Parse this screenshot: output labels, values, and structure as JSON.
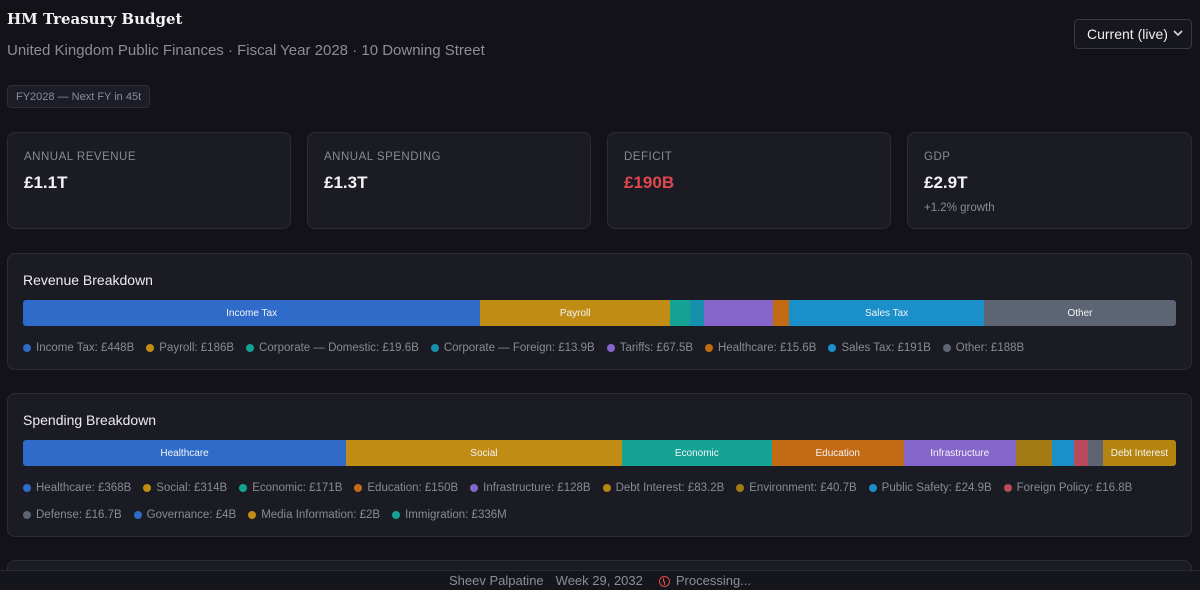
{
  "header": {
    "title": "HM Treasury Budget",
    "subtitle": "United Kingdom Public Finances · Fiscal Year 2028 · 10 Downing Street",
    "view_selected": "Current (live)",
    "fy_badge": "FY2028 — Next FY in 45t"
  },
  "stats": [
    {
      "label": "Annual Revenue",
      "value": "£1.1T",
      "sub": ""
    },
    {
      "label": "Annual Spending",
      "value": "£1.3T",
      "sub": ""
    },
    {
      "label": "Deficit",
      "value": "£190B",
      "sub": "",
      "color": "#e0484d"
    },
    {
      "label": "GDP",
      "value": "£2.9T",
      "sub": "+1.2% growth"
    }
  ],
  "revenue": {
    "title": "Revenue Breakdown",
    "segments": [
      {
        "name": "Income Tax",
        "value": 448,
        "bar_label": "Income Tax",
        "legend": "Income Tax: £448B",
        "color": "#2f6bc9"
      },
      {
        "name": "Payroll",
        "value": 186,
        "bar_label": "Payroll",
        "legend": "Payroll: £186B",
        "color": "#c08c14"
      },
      {
        "name": "Corporate — Domestic",
        "value": 19.6,
        "bar_label": "",
        "legend": "Corporate — Domestic: £19.6B",
        "color": "#14a294"
      },
      {
        "name": "Corporate — Foreign",
        "value": 13.9,
        "bar_label": "",
        "legend": "Corporate — Foreign: £13.9B",
        "color": "#1790ad"
      },
      {
        "name": "Tariffs",
        "value": 67.5,
        "bar_label": "",
        "legend": "Tariffs: £67.5B",
        "color": "#8466cb"
      },
      {
        "name": "Healthcare",
        "value": 15.6,
        "bar_label": "",
        "legend": "Healthcare: £15.6B",
        "color": "#c26a14"
      },
      {
        "name": "Sales Tax",
        "value": 191,
        "bar_label": "Sales Tax",
        "legend": "Sales Tax: £191B",
        "color": "#1a8fca"
      },
      {
        "name": "Other",
        "value": 188,
        "bar_label": "Other",
        "legend": "Other: £188B",
        "color": "#5d6473"
      }
    ]
  },
  "spending": {
    "title": "Spending Breakdown",
    "segments": [
      {
        "name": "Healthcare",
        "value": 368,
        "bar_label": "Healthcare",
        "legend": "Healthcare: £368B",
        "color": "#2f6bc9"
      },
      {
        "name": "Social",
        "value": 314,
        "bar_label": "Social",
        "legend": "Social: £314B",
        "color": "#c08c14"
      },
      {
        "name": "Economic",
        "value": 171,
        "bar_label": "Economic",
        "legend": "Economic: £171B",
        "color": "#14a294"
      },
      {
        "name": "Education",
        "value": 150,
        "bar_label": "Education",
        "legend": "Education: £150B",
        "color": "#c26a14"
      },
      {
        "name": "Infrastructure",
        "value": 128,
        "bar_label": "Infrastructure",
        "legend": "Infrastructure: £128B",
        "color": "#8466cb"
      },
      {
        "name": "Environment",
        "value": 40.7,
        "bar_label": "",
        "legend": "Environment: £40.7B",
        "color": "#a17a14"
      },
      {
        "name": "Public Safety",
        "value": 24.9,
        "bar_label": "",
        "legend": "Public Safety: £24.9B",
        "color": "#1a8fca"
      },
      {
        "name": "Foreign Policy",
        "value": 16.8,
        "bar_label": "",
        "legend": "Foreign Policy: £16.8B",
        "color": "#b84a5c"
      },
      {
        "name": "Defense",
        "value": 16.7,
        "bar_label": "",
        "legend": "Defense: £16.7B",
        "color": "#5d6473"
      },
      {
        "name": "Debt Interest",
        "value": 83.2,
        "bar_label": "Debt Interest",
        "legend": "Debt Interest: £83.2B",
        "color": "#b58512"
      },
      {
        "name": "Governance",
        "value": 4,
        "bar_label": "",
        "legend": "Governance: £4B",
        "color": "#2f6bc9"
      },
      {
        "name": "Media Information",
        "value": 2,
        "bar_label": "",
        "legend": "Media Information: £2B",
        "color": "#c08c14"
      },
      {
        "name": "Immigration",
        "value": 0.336,
        "bar_label": "",
        "legend": "Immigration: £336M",
        "color": "#14a294"
      }
    ],
    "bar_order": [
      "Healthcare",
      "Social",
      "Economic",
      "Education",
      "Infrastructure",
      "Environment",
      "Public Safety",
      "Foreign Policy",
      "Defense",
      "Debt Interest"
    ],
    "legend_order": [
      "Healthcare",
      "Social",
      "Economic",
      "Education",
      "Infrastructure",
      "Debt Interest",
      "Environment",
      "Public Safety",
      "Foreign Policy",
      "Defense",
      "Governance",
      "Media Information",
      "Immigration"
    ]
  },
  "footer": {
    "user": "Sheev Palpatine",
    "date": "Week 29, 2032",
    "status": "Processing..."
  }
}
